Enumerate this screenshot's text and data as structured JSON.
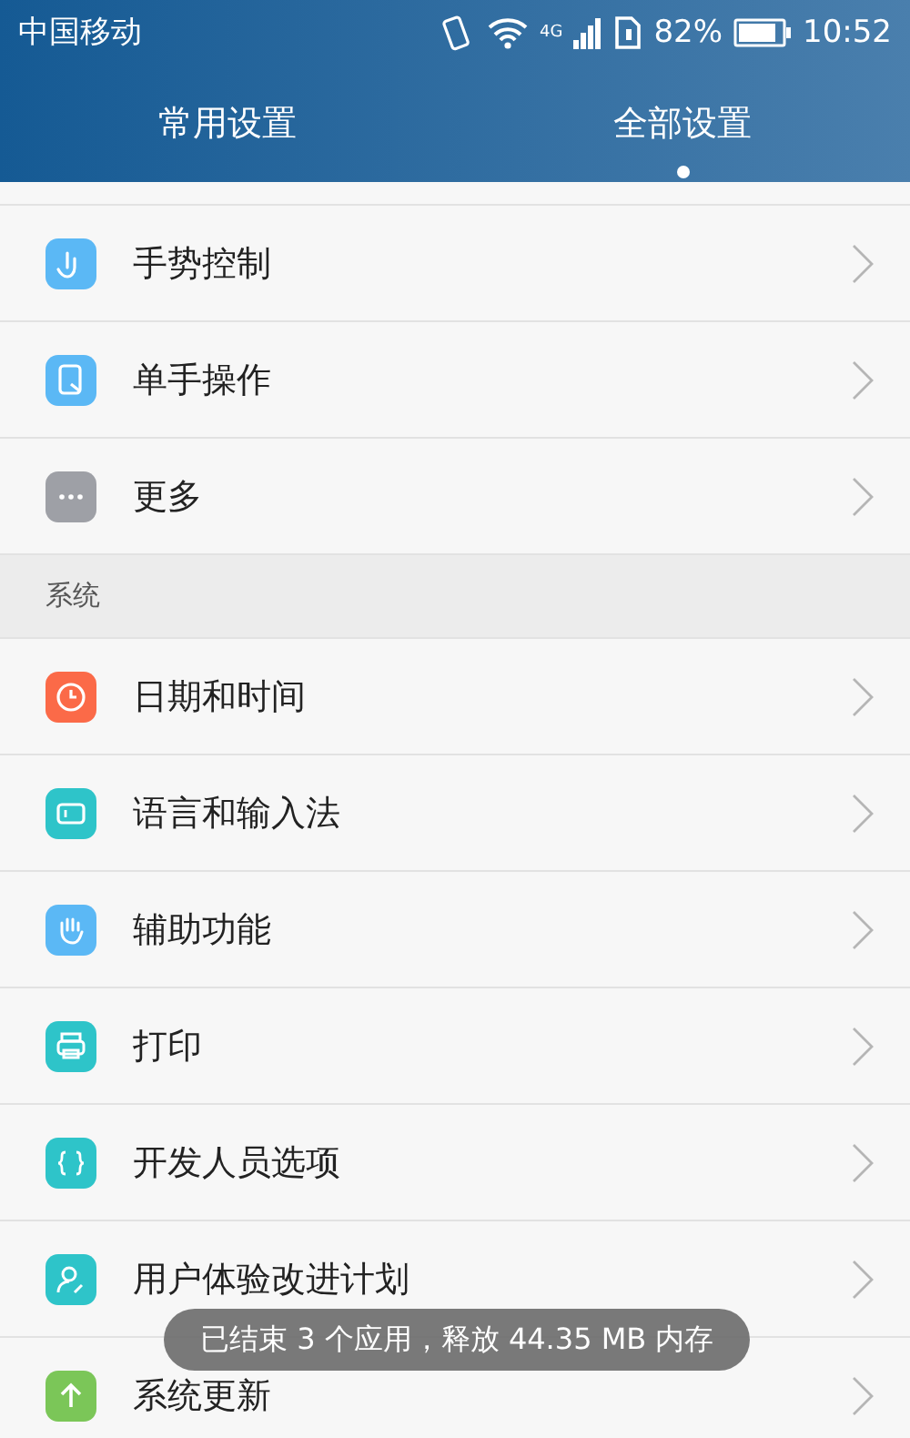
{
  "status_bar": {
    "carrier": "中国移动",
    "network": "4G",
    "battery": "82%",
    "time": "10:52"
  },
  "tabs": [
    {
      "label": "常用设置",
      "selected": false
    },
    {
      "label": "全部设置",
      "selected": true
    }
  ],
  "groups": [
    {
      "items": [
        {
          "label": "手势控制",
          "color": "#5bb8f5"
        },
        {
          "label": "单手操作",
          "color": "#5bb8f5"
        },
        {
          "label": "更多",
          "color": "#9ea0a6"
        }
      ]
    },
    {
      "header": "系统",
      "items": [
        {
          "label": "日期和时间",
          "color": "#fb6a48"
        },
        {
          "label": "语言和输入法",
          "color": "#2ec4c9"
        },
        {
          "label": "辅助功能",
          "color": "#5bb8f5"
        },
        {
          "label": "打印",
          "color": "#2ec4c9"
        },
        {
          "label": "开发人员选项",
          "color": "#2ec4c9"
        },
        {
          "label": "用户体验改进计划",
          "color": "#2ec4c9"
        },
        {
          "label": "系统更新",
          "color": "#7bc658"
        }
      ]
    }
  ],
  "toast": "已结束 3 个应用，释放 44.35 MB 内存"
}
